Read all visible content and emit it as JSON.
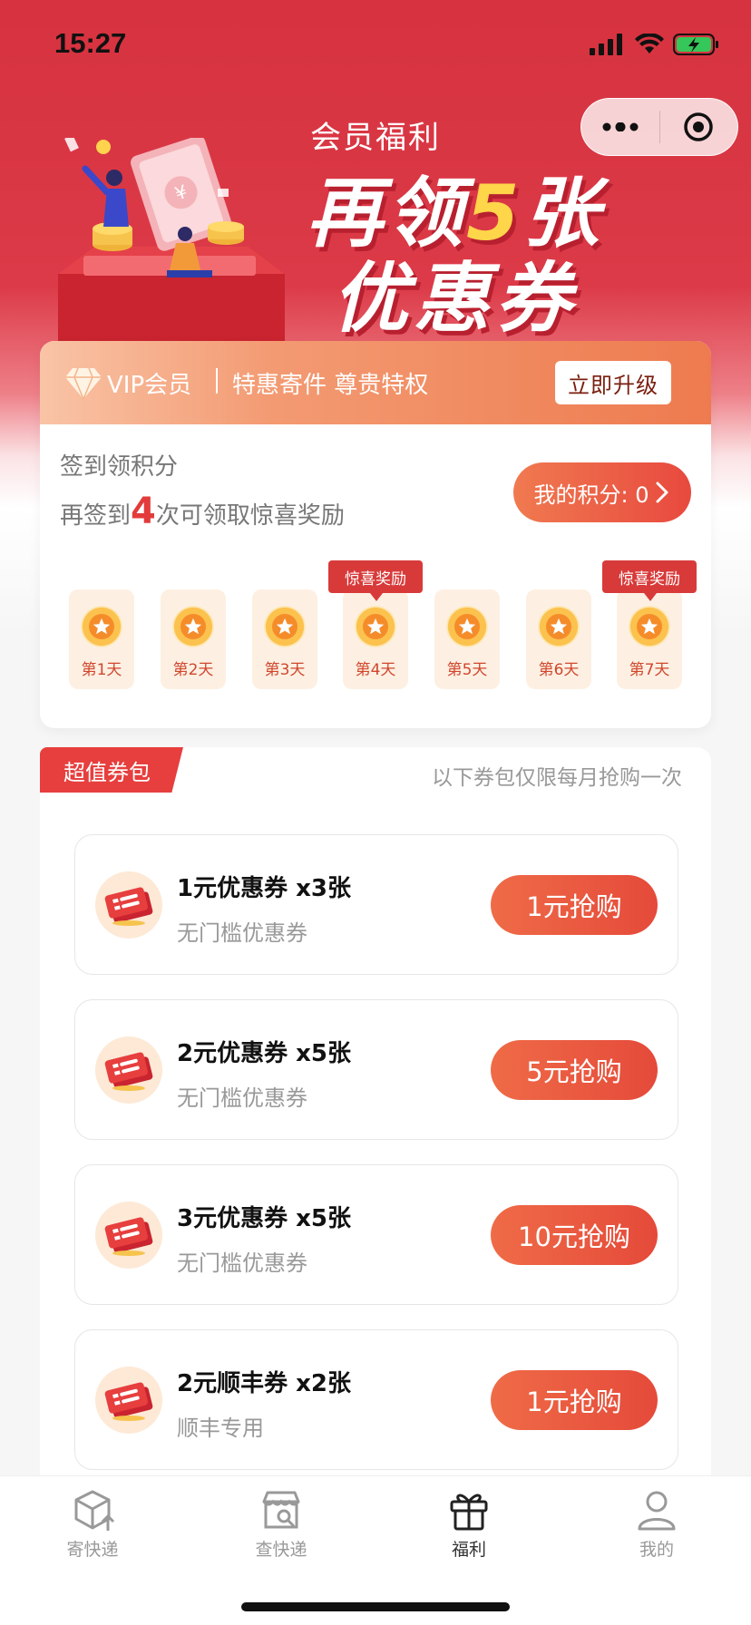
{
  "status_bar": {
    "time": "15:27"
  },
  "banner": {
    "subtitle": "会员福利",
    "line1_pre": "再领",
    "line1_num": "5",
    "line1_post": "张",
    "line2": "优惠券"
  },
  "vip": {
    "label": "VIP会员",
    "perks": "特惠寄件 尊贵特权",
    "upgrade_label": "立即升级"
  },
  "checkin": {
    "title": "签到领积分",
    "tip_pre": "再签到",
    "tip_num": "4",
    "tip_post": "次可领取惊喜奖励",
    "points_label": "我的积分: 0",
    "days": [
      {
        "label": "第1天"
      },
      {
        "label": "第2天"
      },
      {
        "label": "第3天"
      },
      {
        "label": "第4天",
        "reward": "惊喜奖励"
      },
      {
        "label": "第5天"
      },
      {
        "label": "第6天"
      },
      {
        "label": "第7天",
        "reward": "惊喜奖励"
      }
    ]
  },
  "pack": {
    "tag": "超值券包",
    "note": "以下券包仅限每月抢购一次",
    "coupons": [
      {
        "title": "1元优惠券 x3张",
        "sub": "无门槛优惠券",
        "button": "1元抢购"
      },
      {
        "title": "2元优惠券 x5张",
        "sub": "无门槛优惠券",
        "button": "5元抢购"
      },
      {
        "title": "3元优惠券 x5张",
        "sub": "无门槛优惠券",
        "button": "10元抢购"
      },
      {
        "title": "2元顺丰券 x2张",
        "sub": "顺丰专用",
        "button": "1元抢购"
      }
    ]
  },
  "tabs": [
    {
      "label": "寄快递",
      "icon": "package-icon"
    },
    {
      "label": "查快递",
      "icon": "store-search-icon"
    },
    {
      "label": "福利",
      "icon": "gift-icon",
      "active": true
    },
    {
      "label": "我的",
      "icon": "user-icon"
    }
  ],
  "colors": {
    "primary_red": "#e63f3e",
    "accent_orange": "#ee7b4f"
  }
}
